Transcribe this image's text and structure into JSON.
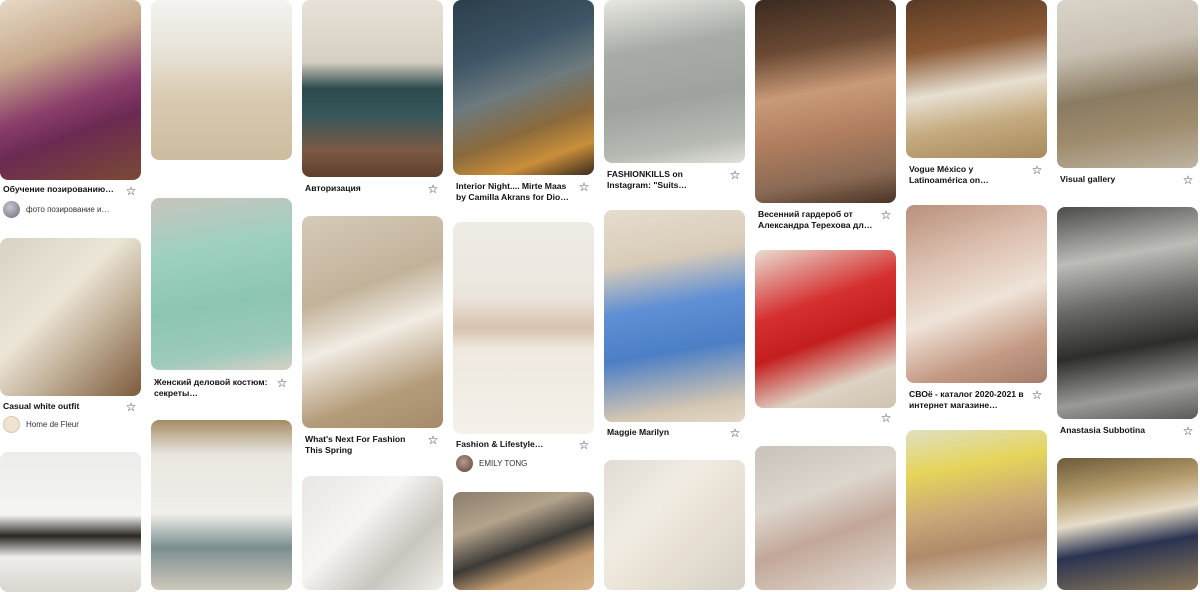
{
  "star_icon": "☆",
  "pins": [
    {
      "title": "Обучение позированию…",
      "author": "фото позирование и…"
    },
    {
      "title": "Casual white outfit",
      "author": "Home de Fleur"
    },
    {
      "title": "Авторизация"
    },
    {
      "title": "Женский деловой костюм: секреты…"
    },
    {
      "title": "What's Next For Fashion This Spring"
    },
    {
      "title": "Interior Night.... Mirte Maas by Camilla Akrans for Dio…"
    },
    {
      "title": "Fashion & Lifestyle…",
      "author": "EMILY TONG"
    },
    {
      "title": "FASHIONKILLS on Instagram: \"Suits…"
    },
    {
      "title": "Maggie Marilyn"
    },
    {
      "title": "Весенний гардероб от Александра Терехова дл…"
    },
    {
      "title": "Vogue México y Latinoamérica on…"
    },
    {
      "title": "СВОё - каталог 2020-2021 в интернет магазине…"
    },
    {
      "title": "Visual gallery"
    },
    {
      "title": "Anastasia Subbotina"
    }
  ]
}
